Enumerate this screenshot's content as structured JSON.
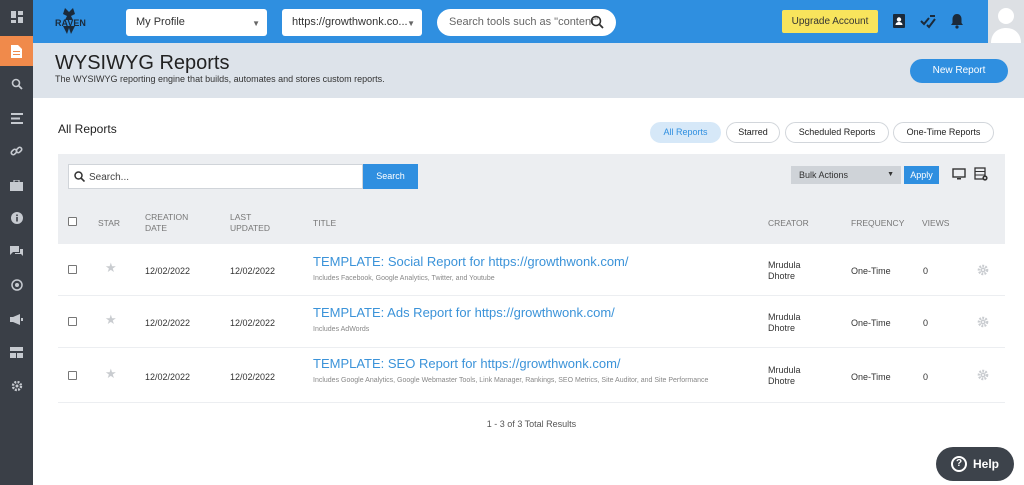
{
  "sidebar": {
    "items": [
      {
        "icon": "dashboard-icon",
        "active": false
      },
      {
        "icon": "reports-icon",
        "active": true
      },
      {
        "icon": "search-icon",
        "active": false
      },
      {
        "icon": "list-icon",
        "active": false
      },
      {
        "icon": "link-icon",
        "active": false
      },
      {
        "icon": "briefcase-icon",
        "active": false
      },
      {
        "icon": "info-icon",
        "active": false
      },
      {
        "icon": "chat-icon",
        "active": false
      },
      {
        "icon": "target-icon",
        "active": false
      },
      {
        "icon": "megaphone-icon",
        "active": false
      },
      {
        "icon": "grid-icon",
        "active": false
      },
      {
        "icon": "settings-icon",
        "active": false
      }
    ]
  },
  "topbar": {
    "logo_text": "RAVEN",
    "profile_select": "My Profile",
    "domain_select": "https://growthwonk.co...",
    "search_placeholder": "Search tools such as \"content\"",
    "upgrade_label": "Upgrade Account"
  },
  "header": {
    "title": "WYSIWYG Reports",
    "subtitle": "The WYSIWYG reporting engine that builds, automates and stores custom reports.",
    "new_report_label": "New Report"
  },
  "main": {
    "heading": "All Reports",
    "filters": [
      {
        "label": "All Reports",
        "active": true
      },
      {
        "label": "Starred",
        "active": false
      },
      {
        "label": "Scheduled Reports",
        "active": false
      },
      {
        "label": "One-Time Reports",
        "active": false
      }
    ],
    "search_placeholder": "Search...",
    "search_button": "Search",
    "bulk_actions": "Bulk Actions",
    "apply_label": "Apply"
  },
  "table": {
    "headers": {
      "star": "STAR",
      "creation_date": "CREATION DATE",
      "last_updated": "LAST UPDATED",
      "title": "TITLE",
      "creator": "CREATOR",
      "frequency": "FREQUENCY",
      "views": "VIEWS"
    },
    "rows": [
      {
        "creation_date": "12/02/2022",
        "last_updated": "12/02/2022",
        "title": "TEMPLATE: Social Report for https://growthwonk.com/",
        "description": "Includes Facebook, Google Analytics, Twitter, and Youtube",
        "creator": "Mrudula Dhotre",
        "frequency": "One-Time",
        "views": "0"
      },
      {
        "creation_date": "12/02/2022",
        "last_updated": "12/02/2022",
        "title": "TEMPLATE: Ads Report for https://growthwonk.com/",
        "description": "Includes AdWords",
        "creator": "Mrudula Dhotre",
        "frequency": "One-Time",
        "views": "0"
      },
      {
        "creation_date": "12/02/2022",
        "last_updated": "12/02/2022",
        "title": "TEMPLATE: SEO Report for https://growthwonk.com/",
        "description": "Includes Google Analytics, Google Webmaster Tools, Link Manager, Rankings, SEO Metrics, Site Auditor, and Site Performance",
        "creator": "Mrudula Dhotre",
        "frequency": "One-Time",
        "views": "0"
      }
    ],
    "total_results": "1 - 3 of 3 Total Results"
  },
  "help_label": "Help"
}
